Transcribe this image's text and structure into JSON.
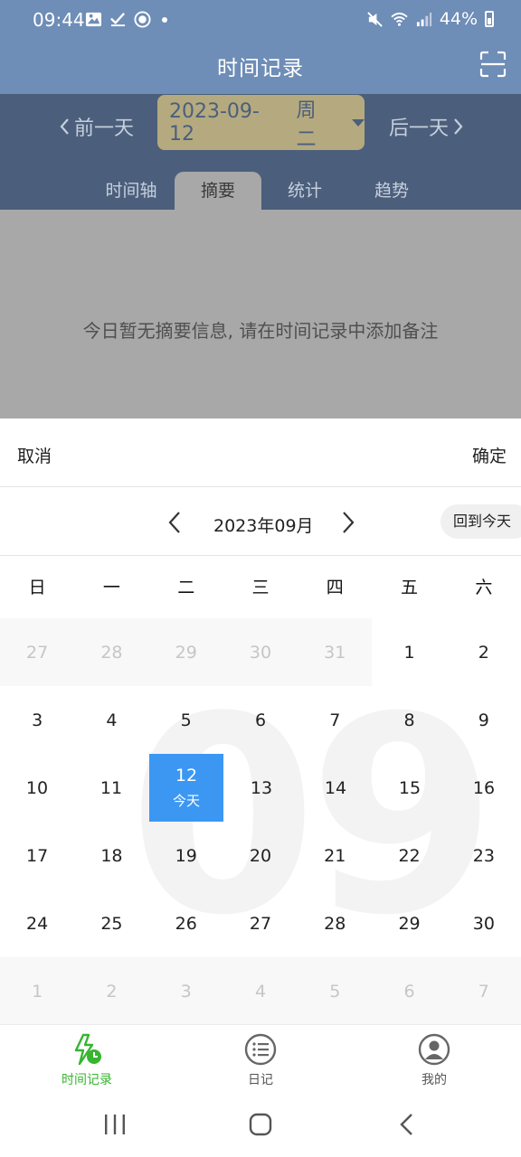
{
  "status_bar": {
    "time": "09:44",
    "battery": "44%",
    "icons": [
      "image-icon",
      "check-icon",
      "circle-app-icon",
      "mute-icon",
      "wifi-icon",
      "signal-icon",
      "battery-icon"
    ]
  },
  "header": {
    "title": "时间记录",
    "scan_icon": "scan-icon",
    "bg_color": "#6e8db7"
  },
  "date_nav": {
    "prev_label": "前一天",
    "next_label": "后一天",
    "date": "2023-09-12",
    "weekday": "周二"
  },
  "tabs": [
    {
      "label": "时间轴",
      "active": false
    },
    {
      "label": "摘要",
      "active": true
    },
    {
      "label": "统计",
      "active": false
    },
    {
      "label": "趋势",
      "active": false
    }
  ],
  "content": {
    "empty_message": "今日暂无摘要信息, 请在时间记录中添加备注"
  },
  "picker": {
    "cancel_label": "取消",
    "confirm_label": "确定",
    "month_label": "2023年09月",
    "today_button": "回到今天",
    "watermark": "09",
    "weekdays": [
      "日",
      "一",
      "二",
      "三",
      "四",
      "五",
      "六"
    ],
    "weeks": [
      [
        {
          "d": "27",
          "o": true
        },
        {
          "d": "28",
          "o": true
        },
        {
          "d": "29",
          "o": true
        },
        {
          "d": "30",
          "o": true
        },
        {
          "d": "31",
          "o": true
        },
        {
          "d": "1"
        },
        {
          "d": "2"
        }
      ],
      [
        {
          "d": "3"
        },
        {
          "d": "4"
        },
        {
          "d": "5"
        },
        {
          "d": "6"
        },
        {
          "d": "7"
        },
        {
          "d": "8"
        },
        {
          "d": "9"
        }
      ],
      [
        {
          "d": "10"
        },
        {
          "d": "11"
        },
        {
          "d": "12",
          "sel": true,
          "sub": "今天"
        },
        {
          "d": "13"
        },
        {
          "d": "14"
        },
        {
          "d": "15"
        },
        {
          "d": "16"
        }
      ],
      [
        {
          "d": "17"
        },
        {
          "d": "18"
        },
        {
          "d": "19"
        },
        {
          "d": "20"
        },
        {
          "d": "21"
        },
        {
          "d": "22"
        },
        {
          "d": "23"
        }
      ],
      [
        {
          "d": "24"
        },
        {
          "d": "25"
        },
        {
          "d": "26"
        },
        {
          "d": "27"
        },
        {
          "d": "28"
        },
        {
          "d": "29"
        },
        {
          "d": "30"
        }
      ],
      [
        {
          "d": "1",
          "o": true
        },
        {
          "d": "2",
          "o": true
        },
        {
          "d": "3",
          "o": true
        },
        {
          "d": "4",
          "o": true
        },
        {
          "d": "5",
          "o": true
        },
        {
          "d": "6",
          "o": true
        },
        {
          "d": "7",
          "o": true
        }
      ]
    ],
    "selected_color": "#3c97f3"
  },
  "bottom_nav": [
    {
      "label": "时间记录",
      "icon": "time-record-icon",
      "active": true
    },
    {
      "label": "日记",
      "icon": "diary-list-icon",
      "active": false
    },
    {
      "label": "我的",
      "icon": "profile-icon",
      "active": false
    }
  ],
  "accent_green": "#36b52f"
}
